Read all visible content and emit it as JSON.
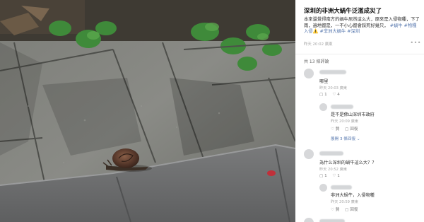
{
  "post": {
    "title": "深圳的非洲大蝸牛泛濫成災了",
    "body": "本來還覺得南方的蝸牛居然這么大，原來是入侵物種，下了雨，遍地都是，一不小心都會踩死好幾只，",
    "tags": [
      "#蝸牛",
      "#物種入侵⚠️",
      "#非洲大蝸牛",
      "#深圳"
    ],
    "meta": "昨天 20:02 廣東",
    "more": "•••"
  },
  "comments": {
    "count_label": "共 13 條評論",
    "items": [
      {
        "text": "哪里",
        "meta": "昨天 20:03 廣東",
        "actions": [
          "▢ 1",
          "♡ 4"
        ],
        "replies": [
          {
            "text": "是不是佛山深圳市政府",
            "meta": "昨天 20:09 廣東",
            "actions": [
              "♡ 贊",
              "▢ 回復"
            ]
          }
        ],
        "expand": "展開 3 條回復 ⌄"
      },
      {
        "text": "為什么深圳的蝸牛這么大？？",
        "meta": "昨天 20:52 廣東",
        "actions": [
          "▢ 1",
          "♡ 1"
        ],
        "replies": [
          {
            "text": "非洲大蝸牛，入侵物種",
            "meta": "昨天 20:59 廣東",
            "actions": [
              "♡ 贊",
              "▢ 回復"
            ]
          }
        ]
      }
    ]
  },
  "colors": {
    "link": "#5b7bb0",
    "meta": "#a8a8a8"
  }
}
